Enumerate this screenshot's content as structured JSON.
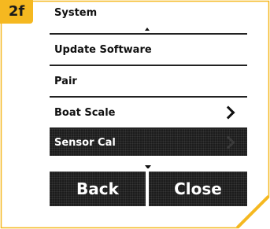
{
  "step": {
    "badge": "2f"
  },
  "colors": {
    "accent": "#f5b820",
    "selected_bg": "#1c1c1c"
  },
  "menu": {
    "title": "System",
    "items": [
      {
        "label": "Update Software",
        "icon": ""
      },
      {
        "label": "Pair",
        "icon": ""
      },
      {
        "label": "Boat Scale",
        "icon": "chevron-right-icon"
      },
      {
        "label": "Sensor Cal",
        "icon": "chevron-right-icon",
        "selected": true
      }
    ]
  },
  "buttons": {
    "back_label": "Back",
    "close_label": "Close"
  }
}
